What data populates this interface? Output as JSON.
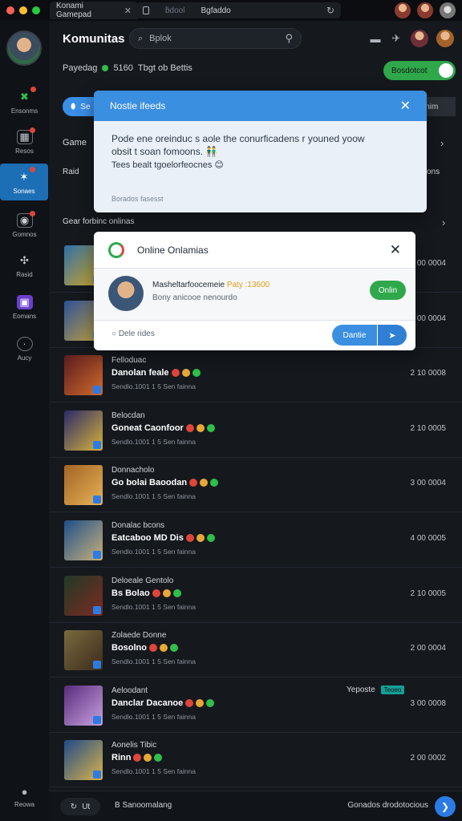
{
  "titlebar": {
    "tab_title": "Konami Gamepad",
    "address": "Bgfaddo",
    "address_left": "ƃdool"
  },
  "sidebar": {
    "items": [
      {
        "label": "Ensonms",
        "icon": "x-icon"
      },
      {
        "label": "Resos",
        "icon": "gamepad-icon"
      },
      {
        "label": "Sonaes",
        "icon": "star-icon"
      },
      {
        "label": "Gomnos",
        "icon": "chat-icon"
      },
      {
        "label": "Rasid",
        "icon": "puzzle-icon"
      },
      {
        "label": "Eomans",
        "icon": "tv-icon"
      },
      {
        "label": "Aucy",
        "icon": "clock-icon"
      }
    ],
    "bottom_label": "Reowa"
  },
  "header": {
    "title": "Komunitas",
    "search_placeholder": "Bplok",
    "sub_left": "Payedag",
    "sub_count": "5160",
    "sub_right": "Tbgt ob Bettis",
    "green_pill": "Bosdotcot"
  },
  "row_pills": {
    "left": "Se",
    "right": "inim"
  },
  "sections": {
    "game_label": "Game",
    "raid_label": "Raid",
    "raid_right": "ons",
    "list_header": "Gear forbinc onlinas"
  },
  "notification": {
    "title": "Nostie ifeeds",
    "line1": "Pode ene oreinduc s aole the conurficadens r youned yoow",
    "line2": "obsit t soan fomoons. 👬",
    "line3": "Tees bealt tgoelorfeocnes 😊",
    "footer": "Borados fasesst"
  },
  "online_modal": {
    "title": "Online Onlamias",
    "user_name": "Masheltarfoocemeie",
    "points": "Paty :13600",
    "user_sub": "Bony anicooe nenourdo",
    "online_btn": "Onlin",
    "search": "Dele rides",
    "primary_btn": "Dantie"
  },
  "games": [
    {
      "l1": "",
      "l2": "",
      "l3": "",
      "num": "1 00 0004",
      "colors": [
        "#2d6fa8",
        "#d7a823"
      ]
    },
    {
      "l1": "",
      "l2": "",
      "l3": "",
      "num": "2 00 0004",
      "colors": [
        "#2a4f9a",
        "#c7a53b"
      ]
    },
    {
      "l1": "Felloduac",
      "l2": "Danolan feale",
      "l3": "Sendlo.1001 1 5 Sen fainna",
      "num": "2 10 0008",
      "colors": [
        "#5a1b1e",
        "#d06a2b"
      ]
    },
    {
      "l1": "Belocdan",
      "l2": "Goneat Caonfoor",
      "l3": "Sendlo.1001 1 5 Sen fainna",
      "num": "2 10 0005",
      "colors": [
        "#2b2a6a",
        "#d7b23a"
      ]
    },
    {
      "l1": "Donnacholo",
      "l2": "Go bolai Baoodan",
      "l3": "Sendlo.1001 1 5 Sen fainna",
      "num": "3 00 0004",
      "colors": [
        "#a36424",
        "#e6b256"
      ]
    },
    {
      "l1": "Donalac bcons",
      "l2": "Eatcaboo  MD Dis",
      "l3": "Sendlo.1001 1 5 Sen fainna",
      "num": "4 00 0005",
      "colors": [
        "#1d4f8a",
        "#c9b07a"
      ]
    },
    {
      "l1": "Deloeale Gentolo",
      "l2": "Bs Bolao",
      "l3": "Sendlo.1001 1 5 Sen fainna",
      "num": "2 10 0005",
      "colors": [
        "#1f3a26",
        "#7d2a22"
      ]
    },
    {
      "l1": "Zolaede Donne",
      "l2": "Bosolno",
      "l3": "Sendlo.1001 1 5 Sen fainna",
      "num": "2 00 0004",
      "colors": [
        "#7a6a3e",
        "#3c2b1c"
      ]
    },
    {
      "l1": "Aeloodant",
      "l2": "Danclar Dacanoe",
      "l3": "Sendlo.1001 1 5 Sen fainna",
      "num": "3 00 0008",
      "colors": [
        "#5a2a7a",
        "#c6a1e0"
      ]
    },
    {
      "l1": "Aonelis Tibic",
      "l2": "Rinn",
      "l3": "Sendlo.1001 1 5 Sen fainna",
      "num": "2 00 0002",
      "colors": [
        "#1f4a8a",
        "#d9b34a"
      ]
    }
  ],
  "youtube_label": "Yeposte",
  "youtube_tag": "Teoeo",
  "footer": {
    "left_btn": "Ut",
    "label": "B Sanoomalang",
    "right_label": "Gonados drodotocious"
  }
}
